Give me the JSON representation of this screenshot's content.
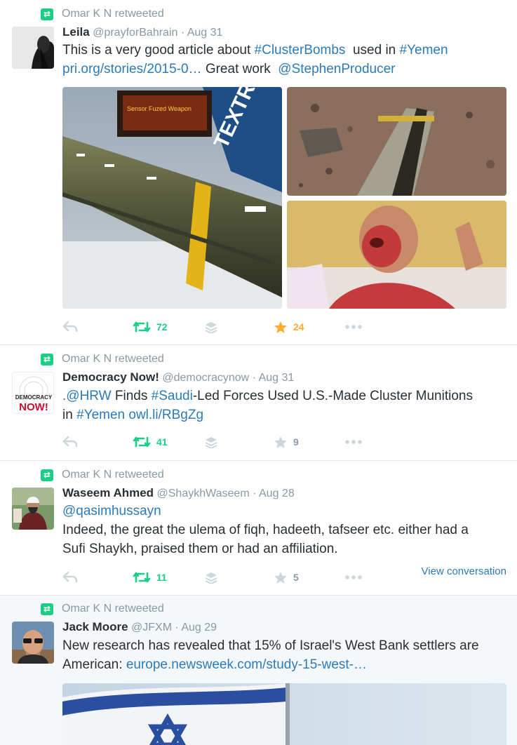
{
  "tweets": [
    {
      "retweeted_by": "Omar K N retweeted",
      "name": "Leila",
      "handle": "@prayforBahrain",
      "time": "Aug 31",
      "text": {
        "a": "This is a very good article about ",
        "b": "#ClusterBombs",
        "c": "  used in ",
        "d": "#Yemen",
        "e": "pri.org/stories/2015-0…",
        "f": " Great work  ",
        "g": "@StephenProducer"
      },
      "media_label": "Sensor Fuzed Weapon",
      "media_brand": "TEXTRON",
      "retweets": "72",
      "favorites": "24"
    },
    {
      "retweeted_by": "Omar K N retweeted",
      "name": "Democracy Now!",
      "handle": "@democracynow",
      "time": "Aug 31",
      "avatar_text": {
        "a": "DEMOCRACY",
        "b": "NOW!"
      },
      "text": {
        "a": ".@HRW",
        "b": " Finds ",
        "c": "#Saudi",
        "d": "-Led Forces Used U.S.-Made Cluster Munitions",
        "e": "in ",
        "f": "#Yemen",
        "g": " ",
        "h": "owl.li/RBgZg"
      },
      "retweets": "41",
      "favorites": "9"
    },
    {
      "retweeted_by": "Omar K N retweeted",
      "name": "Waseem Ahmed",
      "handle": "@ShaykhWaseem",
      "time": "Aug 28",
      "text": {
        "a": "@qasimhussayn",
        "b": "Indeed, the great the ulema of fiqh, hadeeth, tafseer etc. either had a",
        "c": "Sufi Shaykh, praised them or had an affiliation."
      },
      "retweets": "11",
      "favorites": "5",
      "view_conversation": "View conversation"
    },
    {
      "retweeted_by": "Omar K N retweeted",
      "name": "Jack Moore",
      "handle": "@JFXM",
      "time": "Aug 29",
      "text": {
        "a": "New research has revealed that 15% of Israel's West Bank settlers are",
        "b": "American: ",
        "c": "europe.newsweek.com/study-15-west-…"
      }
    }
  ],
  "colors": {
    "link": "#2b7bb9",
    "retweet": "#19cf86",
    "favorite_active": "#ffac33",
    "muted": "#8899a6"
  },
  "icons": [
    "retweet-icon",
    "reply-icon",
    "retweet-icon",
    "layers-icon",
    "star-icon",
    "more-icon"
  ]
}
